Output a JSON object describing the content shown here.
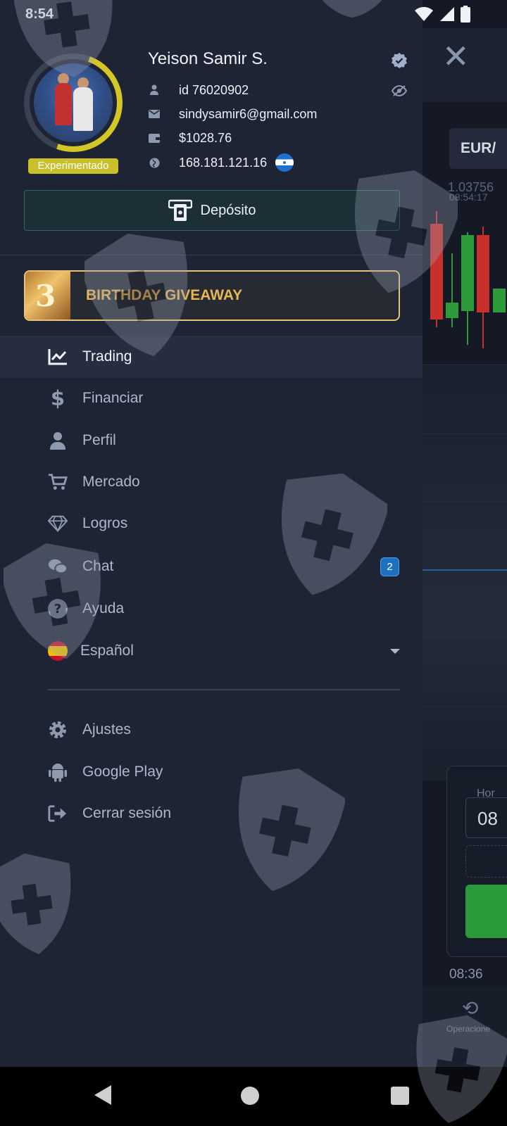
{
  "status_bar": {
    "time": "8:54"
  },
  "profile": {
    "name": "Yeison Samir S.",
    "level": "Experimentado",
    "id": "id 76020902",
    "email": "sindysamir6@gmail.com",
    "balance": "$1028.76",
    "ip": "168.181.121.16"
  },
  "deposit_label": "Depósito",
  "promo": {
    "label": "BIRTHDAY GIVEAWAY"
  },
  "menu": {
    "trading": "Trading",
    "financiar": "Financiar",
    "perfil": "Perfil",
    "mercado": "Mercado",
    "logros": "Logros",
    "chat": "Chat",
    "chat_badge": "2",
    "ayuda": "Ayuda",
    "language": "Español"
  },
  "secondary_menu": {
    "ajustes": "Ajustes",
    "google_play": "Google Play",
    "cerrar_sesion": "Cerrar sesión"
  },
  "background": {
    "pair": "EUR/",
    "price": "1.03756",
    "price_time": "08:54:17",
    "time_label": "Hor",
    "time_value": "08",
    "time_footer": "08:36",
    "operations_label": "Operacione"
  },
  "colors": {
    "accent_gold": "#e9b553",
    "level_badge": "#c9c02a",
    "chat_badge": "#1e6fbd",
    "candle_red": "#c9302c",
    "candle_green": "#2e9b3a"
  }
}
